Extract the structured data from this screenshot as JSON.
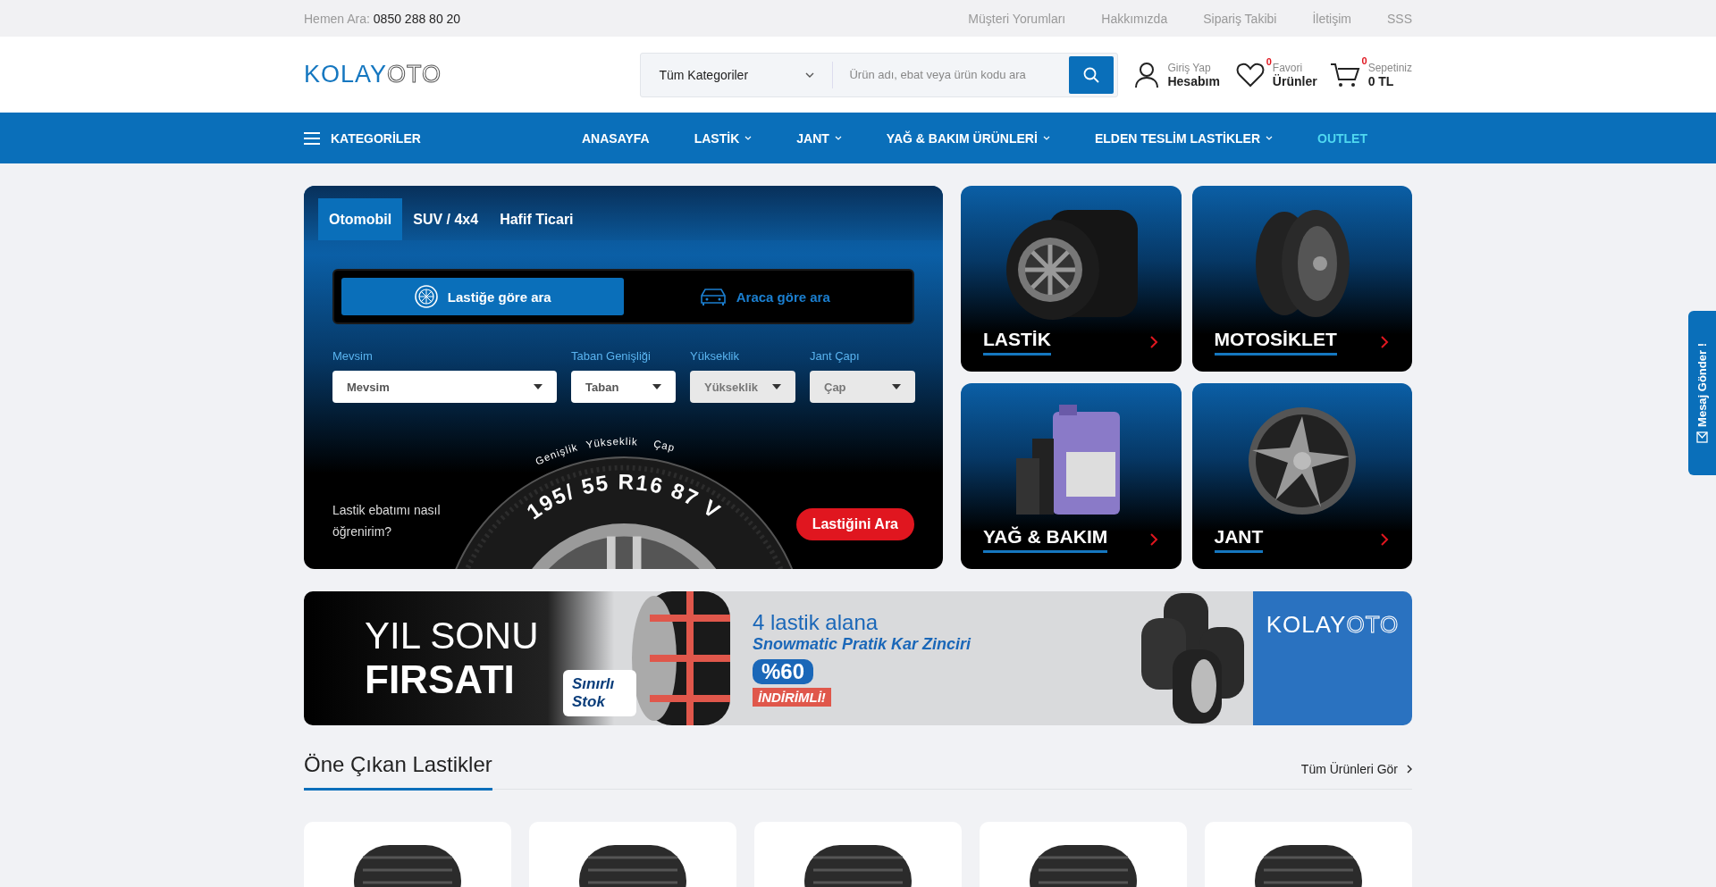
{
  "topbar": {
    "phone_label": "Hemen Ara:",
    "phone": "0850 288 80 20",
    "links": [
      "Müşteri Yorumları",
      "Hakkımızda",
      "Sipariş Takibi",
      "İletişim",
      "SSS"
    ]
  },
  "header": {
    "logo": {
      "first": "KOLAY",
      "second": "OTO"
    },
    "search": {
      "category": "Tüm Kategoriler",
      "placeholder": "Ürün adı, ebat veya ürün kodu ara"
    },
    "account": {
      "line1": "Giriş Yap",
      "line2": "Hesabım"
    },
    "favorites": {
      "line1": "Favori",
      "line2": "Ürünler",
      "count": "0"
    },
    "cart": {
      "line1": "Sepetiniz",
      "line2": "0 TL",
      "count": "0"
    }
  },
  "nav": {
    "categories": "KATEGORİLER",
    "items": [
      {
        "label": "ANASAYFA",
        "dropdown": false,
        "highlight": false
      },
      {
        "label": "LASTİK",
        "dropdown": true,
        "highlight": false
      },
      {
        "label": "JANT",
        "dropdown": true,
        "highlight": false
      },
      {
        "label": "YAĞ & BAKIM ÜRÜNLERİ",
        "dropdown": true,
        "highlight": false
      },
      {
        "label": "ELDEN TESLİM LASTİKLER",
        "dropdown": true,
        "highlight": false
      },
      {
        "label": "OUTLET",
        "dropdown": false,
        "highlight": true
      }
    ]
  },
  "finder": {
    "tabs": [
      {
        "label": "Otomobil",
        "selected": true
      },
      {
        "label": "SUV / 4x4",
        "selected": false
      },
      {
        "label": "Hafif Ticari",
        "selected": false
      }
    ],
    "modes": [
      {
        "label": "Lastiğe göre ara",
        "kind": "tire",
        "selected": true
      },
      {
        "label": "Araca göre ara",
        "kind": "car",
        "selected": false
      }
    ],
    "fields": [
      {
        "label": "Mevsim",
        "value": "Mevsim",
        "disabled": false
      },
      {
        "label": "Taban Genişliği",
        "value": "Taban",
        "disabled": false
      },
      {
        "label": "Yükseklik",
        "value": "Yükseklik",
        "disabled": true
      },
      {
        "label": "Jant Çapı",
        "value": "Çap",
        "disabled": true
      }
    ],
    "diagram": {
      "labels": [
        "Genişlik",
        "Yükseklik",
        "Çap"
      ],
      "size": "195/ 55 R16 87 V"
    },
    "help": "Lastik ebatımı nasıl öğrenirim?",
    "submit": "Lastiğini Ara"
  },
  "category_cards": [
    {
      "title": "LASTİK",
      "kind": "tire"
    },
    {
      "title": "MOTOSİKLET",
      "kind": "moto"
    },
    {
      "title": "YAĞ & BAKIM",
      "kind": "oil"
    },
    {
      "title": "JANT",
      "kind": "rim"
    }
  ],
  "banner": {
    "headline": "YIL SONU",
    "headline_bold": "FIRSATI",
    "stock": "Sınırlı Stok",
    "offer": "4 lastik alana",
    "product": "Snowmatic Pratik Kar Zinciri",
    "discount": "%60",
    "discount_note": "İNDİRİMLİ!",
    "logo": {
      "first": "KOLAY",
      "second": "OTO"
    }
  },
  "featured": {
    "title": "Öne Çıkan Lastikler",
    "link": "Tüm Ürünleri Gör"
  },
  "side_tab": "Mesaj Gönder !"
}
